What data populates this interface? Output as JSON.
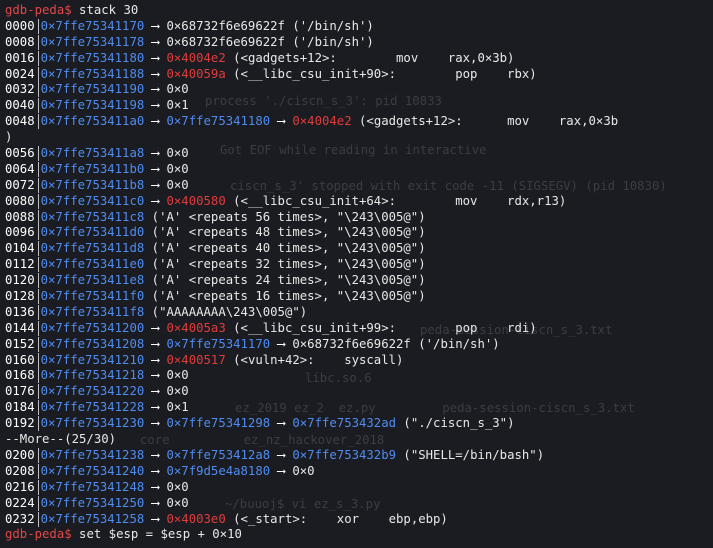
{
  "window": {
    "title": "gdb-peda"
  },
  "prompt": "gdb-peda$",
  "command": "stack 30",
  "more_prompt": "--More--(25/30)",
  "last_command": "set $esp = $esp + 0×10",
  "rows": [
    {
      "off": "0000",
      "addr": "0×7ffe75341170",
      "rest": [
        {
          "t": "a",
          "v": " ⟶ "
        },
        {
          "t": "w",
          "v": "0×68732f6e69622f ('/bin/sh')"
        }
      ]
    },
    {
      "off": "0008",
      "addr": "0×7ffe75341178",
      "rest": [
        {
          "t": "a",
          "v": " ⟶ "
        },
        {
          "t": "w",
          "v": "0×68732f6e69622f ('/bin/sh')"
        }
      ]
    },
    {
      "off": "0016",
      "addr": "0×7ffe75341180",
      "rest": [
        {
          "t": "a",
          "v": " ⟶ "
        },
        {
          "t": "r",
          "v": "0×4004e2"
        },
        {
          "t": "w",
          "v": " (<gadgets+12>:        mov    rax,0×3b)"
        }
      ]
    },
    {
      "off": "0024",
      "addr": "0×7ffe75341188",
      "rest": [
        {
          "t": "a",
          "v": " ⟶ "
        },
        {
          "t": "r",
          "v": "0×40059a"
        },
        {
          "t": "w",
          "v": " (<__libc_csu_init+90>:        pop    rbx)"
        }
      ]
    },
    {
      "off": "0032",
      "addr": "0×7ffe75341190",
      "rest": [
        {
          "t": "a",
          "v": " ⟶ "
        },
        {
          "t": "w",
          "v": "0×0"
        }
      ]
    },
    {
      "off": "0040",
      "addr": "0×7ffe75341198",
      "rest": [
        {
          "t": "a",
          "v": " ⟶ "
        },
        {
          "t": "w",
          "v": "0×1"
        }
      ]
    },
    {
      "off": "0048",
      "addr": "0×7ffe753411a0",
      "rest": [
        {
          "t": "a",
          "v": " ⟶ "
        },
        {
          "t": "b",
          "v": "0×7ffe75341180"
        },
        {
          "t": "a",
          "v": " ⟶ "
        },
        {
          "t": "r",
          "v": "0×4004e2"
        },
        {
          "t": "w",
          "v": " (<gadgets+12>:      mov    rax,0×3b"
        }
      ]
    },
    {
      "cont": ")"
    },
    {
      "off": "0056",
      "addr": "0×7ffe753411a8",
      "rest": [
        {
          "t": "a",
          "v": " ⟶ "
        },
        {
          "t": "w",
          "v": "0×0"
        }
      ]
    },
    {
      "off": "0064",
      "addr": "0×7ffe753411b0",
      "rest": [
        {
          "t": "a",
          "v": " ⟶ "
        },
        {
          "t": "w",
          "v": "0×0"
        }
      ]
    },
    {
      "off": "0072",
      "addr": "0×7ffe753411b8",
      "rest": [
        {
          "t": "a",
          "v": " ⟶ "
        },
        {
          "t": "w",
          "v": "0×0"
        }
      ]
    },
    {
      "off": "0080",
      "addr": "0×7ffe753411c0",
      "rest": [
        {
          "t": "a",
          "v": " ⟶ "
        },
        {
          "t": "r",
          "v": "0×400580"
        },
        {
          "t": "w",
          "v": " (<__libc_csu_init+64>:        mov    rdx,r13)"
        }
      ]
    },
    {
      "off": "0088",
      "addr": "0×7ffe753411c8",
      "rest": [
        {
          "t": "w",
          "v": " ('A' <repeats 56 times>, \"\\243\\005@\")"
        }
      ]
    },
    {
      "off": "0096",
      "addr": "0×7ffe753411d0",
      "rest": [
        {
          "t": "w",
          "v": " ('A' <repeats 48 times>, \"\\243\\005@\")"
        }
      ]
    },
    {
      "off": "0104",
      "addr": "0×7ffe753411d8",
      "rest": [
        {
          "t": "w",
          "v": " ('A' <repeats 40 times>, \"\\243\\005@\")"
        }
      ]
    },
    {
      "off": "0112",
      "addr": "0×7ffe753411e0",
      "rest": [
        {
          "t": "w",
          "v": " ('A' <repeats 32 times>, \"\\243\\005@\")"
        }
      ]
    },
    {
      "off": "0120",
      "addr": "0×7ffe753411e8",
      "rest": [
        {
          "t": "w",
          "v": " ('A' <repeats 24 times>, \"\\243\\005@\")"
        }
      ]
    },
    {
      "off": "0128",
      "addr": "0×7ffe753411f0",
      "rest": [
        {
          "t": "w",
          "v": " ('A' <repeats 16 times>, \"\\243\\005@\")"
        }
      ]
    },
    {
      "off": "0136",
      "addr": "0×7ffe753411f8",
      "rest": [
        {
          "t": "w",
          "v": " (\"AAAAAAAA\\243\\005@\")"
        }
      ]
    },
    {
      "off": "0144",
      "addr": "0×7ffe75341200",
      "rest": [
        {
          "t": "a",
          "v": " ⟶ "
        },
        {
          "t": "r",
          "v": "0×4005a3"
        },
        {
          "t": "w",
          "v": " (<__libc_csu_init+99>:        pop    rdi)"
        }
      ]
    },
    {
      "off": "0152",
      "addr": "0×7ffe75341208",
      "rest": [
        {
          "t": "a",
          "v": " ⟶ "
        },
        {
          "t": "b",
          "v": "0×7ffe75341170"
        },
        {
          "t": "a",
          "v": " ⟶ "
        },
        {
          "t": "w",
          "v": "0×68732f6e69622f ('/bin/sh')"
        }
      ]
    },
    {
      "off": "0160",
      "addr": "0×7ffe75341210",
      "rest": [
        {
          "t": "a",
          "v": " ⟶ "
        },
        {
          "t": "r",
          "v": "0×400517"
        },
        {
          "t": "w",
          "v": " (<vuln+42>:    syscall)"
        }
      ]
    },
    {
      "off": "0168",
      "addr": "0×7ffe75341218",
      "rest": [
        {
          "t": "a",
          "v": " ⟶ "
        },
        {
          "t": "w",
          "v": "0×0"
        }
      ]
    },
    {
      "off": "0176",
      "addr": "0×7ffe75341220",
      "rest": [
        {
          "t": "a",
          "v": " ⟶ "
        },
        {
          "t": "w",
          "v": "0×0"
        }
      ]
    },
    {
      "off": "0184",
      "addr": "0×7ffe75341228",
      "rest": [
        {
          "t": "a",
          "v": " ⟶ "
        },
        {
          "t": "w",
          "v": "0×1"
        }
      ]
    },
    {
      "off": "0192",
      "addr": "0×7ffe75341230",
      "rest": [
        {
          "t": "a",
          "v": " ⟶ "
        },
        {
          "t": "b",
          "v": "0×7ffe75341298"
        },
        {
          "t": "a",
          "v": " ⟶ "
        },
        {
          "t": "b",
          "v": "0×7ffe753432ad"
        },
        {
          "t": "w",
          "v": " (\"./ciscn_s_3\")"
        }
      ]
    },
    {
      "more": true
    },
    {
      "off": "0200",
      "addr": "0×7ffe75341238",
      "rest": [
        {
          "t": "a",
          "v": " ⟶ "
        },
        {
          "t": "b",
          "v": "0×7ffe753412a8"
        },
        {
          "t": "a",
          "v": " ⟶ "
        },
        {
          "t": "b",
          "v": "0×7ffe753432b9"
        },
        {
          "t": "w",
          "v": " (\"SHELL=/bin/bash\")"
        }
      ]
    },
    {
      "off": "0208",
      "addr": "0×7ffe75341240",
      "rest": [
        {
          "t": "a",
          "v": " ⟶ "
        },
        {
          "t": "b",
          "v": "0×7f9d5e4a8180"
        },
        {
          "t": "a",
          "v": " ⟶ "
        },
        {
          "t": "w",
          "v": "0×0"
        }
      ]
    },
    {
      "off": "0216",
      "addr": "0×7ffe75341248",
      "rest": [
        {
          "t": "a",
          "v": " ⟶ "
        },
        {
          "t": "w",
          "v": "0×0"
        }
      ]
    },
    {
      "off": "0224",
      "addr": "0×7ffe75341250",
      "rest": [
        {
          "t": "a",
          "v": " ⟶ "
        },
        {
          "t": "w",
          "v": "0×0"
        }
      ]
    },
    {
      "off": "0232",
      "addr": "0×7ffe75341258",
      "rest": [
        {
          "t": "a",
          "v": " ⟶ "
        },
        {
          "t": "r",
          "v": "0×4003e0"
        },
        {
          "t": "w",
          "v": " (<_start>:    xor    ebp,ebp)"
        }
      ]
    }
  ],
  "background_ghost_text": [
    "process './ciscn_s_3': pid 10833",
    "Got EOF while reading in interactive",
    "ciscn_s_3' stopped with exit code -11 (SIGSEGV) (pid 10830)",
    "peda-session-ciscn_s_3.txt",
    "libc.so.6",
    "ez_2019 ez_2  ez.py         peda-session-ciscn_s_3.txt",
    "core          ez_nz_hackover_2018",
    "~/buuoj$ vi ez_s_3.py"
  ],
  "colors": {
    "background": "#1b1c21",
    "prompt": "#e04848",
    "address": "#4f8cf0",
    "code_pointer": "#e03c3c",
    "text": "#e8e8e8"
  }
}
